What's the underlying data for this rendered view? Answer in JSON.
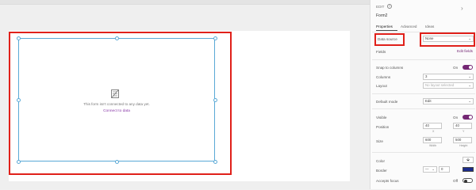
{
  "canvas": {
    "empty_message": "This form isn't connected to any data yet.",
    "connect_link": "Connect to data"
  },
  "panel": {
    "edit_label": "EDIT",
    "help_icon": "?",
    "control_name": "Form2",
    "tabs": [
      "Properties",
      "Advanced",
      "Ideas"
    ],
    "data_source": {
      "label": "Data source",
      "value": "None"
    },
    "fields": {
      "label": "Fields",
      "link": "Edit fields"
    },
    "snap_to_columns": {
      "label": "Snap to columns",
      "state": "On"
    },
    "columns": {
      "label": "Columns",
      "value": "3"
    },
    "layout": {
      "label": "Layout",
      "value": "No layout selected"
    },
    "default_mode": {
      "label": "Default mode",
      "value": "Edit"
    },
    "visible": {
      "label": "Visible",
      "state": "On"
    },
    "position": {
      "label": "Position",
      "x": "40",
      "y": "40",
      "x_label": "X",
      "y_label": "Y"
    },
    "size": {
      "label": "Size",
      "width": "600",
      "height": "500",
      "width_label": "Width",
      "height_label": "Height"
    },
    "color": {
      "label": "Color"
    },
    "border": {
      "label": "Border",
      "value": "0",
      "style": "—",
      "color": "#1a2a8a"
    },
    "accepts_focus": {
      "label": "Accepts focus",
      "state": "Off"
    }
  },
  "colors": {
    "accent": "#742774",
    "highlight": "#e0201a",
    "selection": "#5aa9d6"
  },
  "icons": {
    "form": "form-icon",
    "help": "help-icon",
    "chevron": "chevron-down-icon",
    "expand": "chevron-right-icon",
    "paint": "paint-bucket-icon"
  }
}
